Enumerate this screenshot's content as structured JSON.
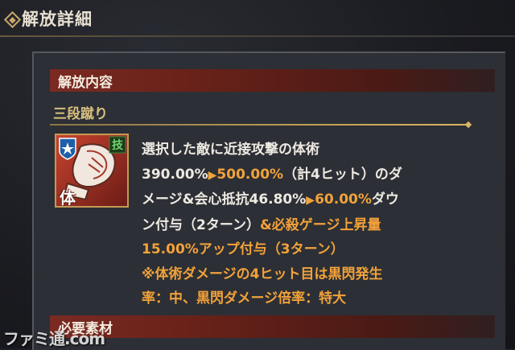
{
  "header": {
    "title": "解放詳細"
  },
  "section": {
    "title": "解放内容"
  },
  "skill": {
    "name": "三段蹴り",
    "badge": "技",
    "type_char": "体",
    "lines": [
      {
        "seg1": "選択した敵に近接攻撃の体術"
      },
      {
        "seg1": "390.00%",
        "arrow": "▶",
        "seg2": "500.00%",
        "seg3": "（計4ヒット）のダ"
      },
      {
        "seg1": "メージ&会心抵抗46.80%",
        "arrow": "▶",
        "seg2": "60.00%",
        "seg3": "ダウ"
      },
      {
        "seg1": "ン付与（2ターン）",
        "seg2": "&必殺ゲージ上昇量"
      },
      {
        "seg2": "15.00%アップ付与（3ターン）"
      },
      {
        "seg2": "※体術ダメージの4ヒット目は黒閃発生"
      },
      {
        "seg2": "率：中、黒閃ダメージ倍率：特大"
      }
    ]
  },
  "requirements": {
    "title": "必要素材"
  },
  "watermark": "ファミ通.com",
  "colors": {
    "accent_orange": "#f2a23a",
    "gold": "#d9bf7e",
    "section_red": "#7a2a22"
  }
}
